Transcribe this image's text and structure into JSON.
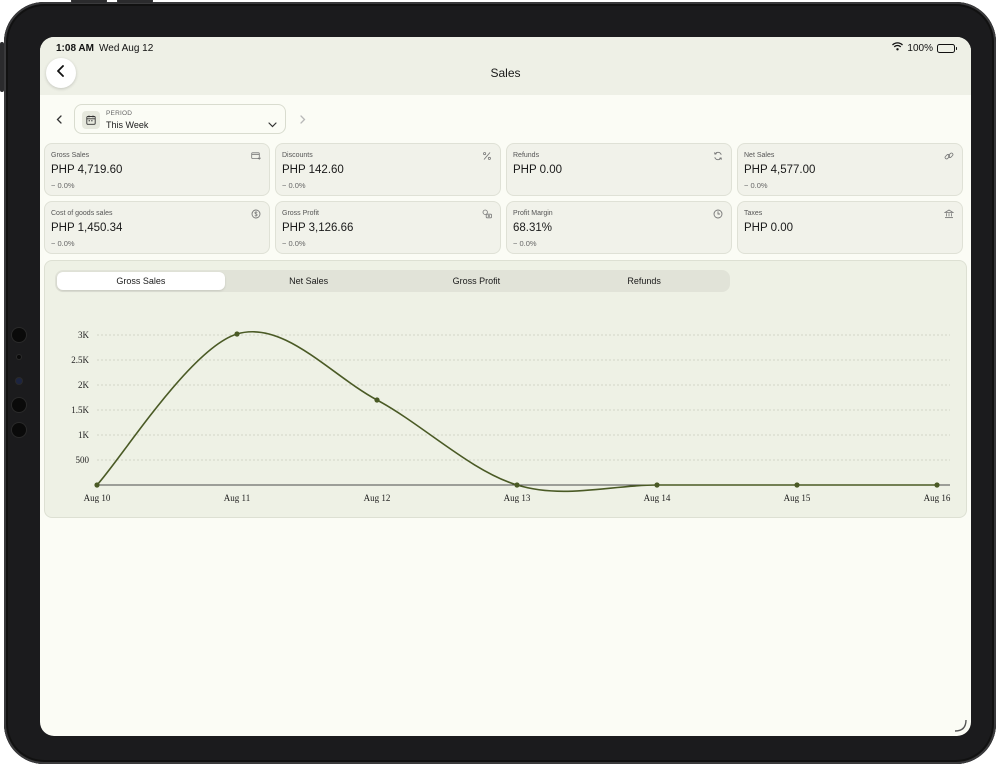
{
  "status_bar": {
    "time": "1:08 AM",
    "date": "Wed Aug 12",
    "battery": "100%"
  },
  "header": {
    "title": "Sales"
  },
  "period": {
    "label": "PERIOD",
    "value": "This Week"
  },
  "metrics": [
    {
      "name": "gross-sales",
      "label": "Gross Sales",
      "value": "PHP 4,719.60",
      "change": "− 0.0%",
      "icon": "receipt-icon"
    },
    {
      "name": "discounts",
      "label": "Discounts",
      "value": "PHP 142.60",
      "change": "− 0.0%",
      "icon": "percent-icon"
    },
    {
      "name": "refunds",
      "label": "Refunds",
      "value": "PHP 0.00",
      "change": "",
      "icon": "refresh-icon"
    },
    {
      "name": "net-sales",
      "label": "Net Sales",
      "value": "PHP 4,577.00",
      "change": "− 0.0%",
      "icon": "link-icon"
    },
    {
      "name": "cogs",
      "label": "Cost of goods sales",
      "value": "PHP 1,450.34",
      "change": "− 0.0%",
      "icon": "coin-icon"
    },
    {
      "name": "gross-profit",
      "label": "Gross Profit",
      "value": "PHP 3,126.66",
      "change": "− 0.0%",
      "icon": "money-icon"
    },
    {
      "name": "profit-margin",
      "label": "Profit Margin",
      "value": "68.31%",
      "change": "− 0.0%",
      "icon": "clock-icon"
    },
    {
      "name": "taxes",
      "label": "Taxes",
      "value": "PHP 0.00",
      "change": "",
      "icon": "bank-icon"
    }
  ],
  "chart_tabs": [
    "Gross Sales",
    "Net Sales",
    "Gross Profit",
    "Refunds"
  ],
  "chart_tabs_active": 0,
  "chart_data": {
    "type": "line",
    "categories": [
      "Aug 10",
      "Aug 11",
      "Aug 12",
      "Aug 13",
      "Aug 14",
      "Aug 15",
      "Aug 16"
    ],
    "series": [
      {
        "values": [
          0,
          3020,
          1700,
          0,
          0,
          0,
          0
        ]
      }
    ],
    "y_ticks": [
      500,
      1000,
      1500,
      2000,
      2500,
      3000
    ],
    "y_tick_labels": [
      "500",
      "1K",
      "1.5K",
      "2K",
      "2.5K",
      "3K"
    ],
    "ylim": [
      0,
      3000
    ],
    "grid": true,
    "line_color": "#4a5a25"
  }
}
